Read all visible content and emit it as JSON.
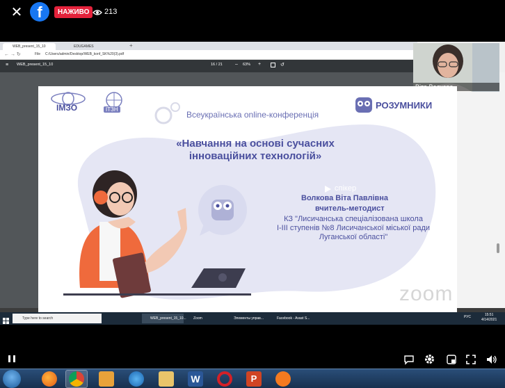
{
  "fb": {
    "live_label": "НАЖИВО",
    "viewers_count": "213",
    "close_icon": "close-icon",
    "logo_icon": "facebook-logo-icon",
    "eye_icon": "eye-icon"
  },
  "browser": {
    "tabs": [
      {
        "label": "WEB_present_15_10"
      },
      {
        "label": "EDUGAMES"
      }
    ],
    "address": "C:/Users/admin/Desktop/WEB_konf_SK%20(3).pdf",
    "file_label": "File"
  },
  "pdf": {
    "title": "WEB_present_15_10",
    "page": "16",
    "page_total": "/ 21",
    "zoom": "63%"
  },
  "webcam": {
    "name": "Віта Волкова"
  },
  "slide": {
    "logo_imzo": "ІМЗО",
    "logo_ptsn": "ІТЗН",
    "brand": "РОЗУМНИКИ",
    "conf": "Всеукраїнська online-конференція",
    "title_line1": "«Навчання на основі сучасних",
    "title_line2": "інноваційних технологій»",
    "speaker_label": "спікер",
    "speaker_name": "Волкова Віта Павлівна",
    "speaker_role": "вчитель-методист",
    "org_line1": "КЗ \"Лисичанська спеціалізована школа",
    "org_line2": "І-ІІІ ступенів №8 Лисичанської міської ради",
    "org_line3": "Луганської області\"",
    "zoom_watermark": "zoom",
    "colors": {
      "accent": "#4a4f9e",
      "blob": "#e5e6f4",
      "orange": "#ef6a3c"
    }
  },
  "inner_taskbar": {
    "search": "Type here to search",
    "apps": [
      {
        "label": "WEB_present_15_10..."
      },
      {
        "label": "Zoom"
      },
      {
        "label": "Элементы управ..."
      },
      {
        "label": "Facebook - Avast S..."
      }
    ],
    "lang": "РУС",
    "time": "15:51",
    "date": "4/14/2021"
  },
  "controls": {
    "pause_icon": "pause-icon",
    "captions_icon": "captions-icon",
    "settings_icon": "gear-icon",
    "pip_icon": "picture-in-picture-icon",
    "fullscreen_icon": "fullscreen-icon",
    "volume_icon": "volume-icon"
  },
  "win7": {
    "icons": [
      "firefox-icon",
      "chrome-icon",
      "media-player-icon",
      "ie-icon",
      "folder-icon",
      "word-icon",
      "opera-icon",
      "powerpoint-icon",
      "avast-icon"
    ]
  }
}
